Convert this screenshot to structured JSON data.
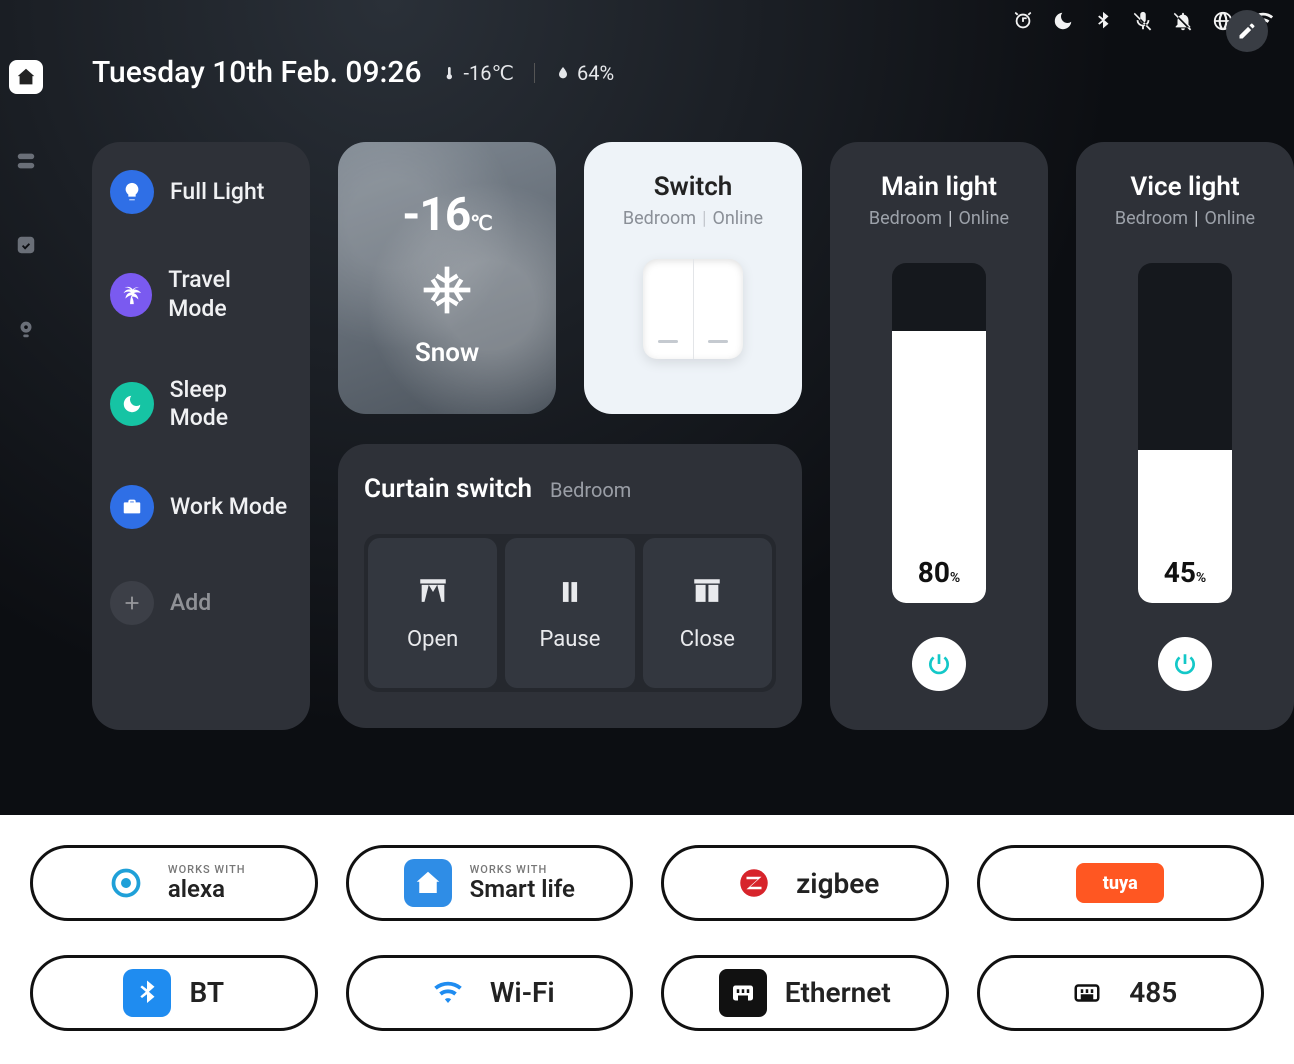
{
  "header": {
    "datetime": "Tuesday 10th Feb. 09:26",
    "temperature": "-16℃",
    "humidity": "64%"
  },
  "scenes": [
    {
      "label": "Full Light",
      "icon": "bulb",
      "color": "#2f6fe6"
    },
    {
      "label": "Travel Mode",
      "icon": "palm",
      "color": "#7a5af0"
    },
    {
      "label": "Sleep Mode",
      "icon": "moon",
      "color": "#16c4a4"
    },
    {
      "label": "Work Mode",
      "icon": "briefcase",
      "color": "#2f6fe6"
    },
    {
      "label": "Add",
      "icon": "plus",
      "color": "#4a4e56"
    }
  ],
  "weather": {
    "temp": "-16",
    "unit": "℃",
    "condition": "Snow"
  },
  "switch": {
    "title": "Switch",
    "room": "Bedroom",
    "status": "Online"
  },
  "curtain": {
    "title": "Curtain switch",
    "room": "Bedroom",
    "buttons": {
      "open": "Open",
      "pause": "Pause",
      "close": "Close"
    }
  },
  "lights": [
    {
      "title": "Main light",
      "room": "Bedroom",
      "status": "Online",
      "percent": 80
    },
    {
      "title": "Vice light",
      "room": "Bedroom",
      "status": "Online",
      "percent": 45
    }
  ],
  "compat": {
    "alexa_sub": "Works with",
    "alexa": "alexa",
    "smartlife_sub": "Works with",
    "smartlife": "Smart life",
    "zigbee": "zigbee",
    "tuya": "tuya",
    "bt": "BT",
    "wifi": "Wi-Fi",
    "ethernet": "Ethernet",
    "rs485": "485"
  }
}
